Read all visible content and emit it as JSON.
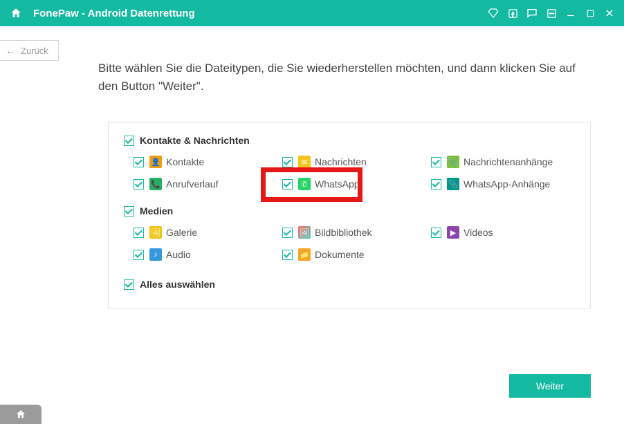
{
  "titlebar": {
    "title": "FonePaw - Android Datenrettung"
  },
  "back_button": "Zurück",
  "instruction": "Bitte wählen Sie die Dateitypen, die Sie wiederherstellen möchten, und dann klicken Sie auf den Button \"Weiter\".",
  "sections": {
    "contacts_messages": "Kontakte & Nachrichten",
    "media": "Medien",
    "select_all": "Alles auswählen"
  },
  "items": {
    "kontakte": "Kontakte",
    "nachrichten": "Nachrichten",
    "nachrichtenanhaenge": "Nachrichtenanhänge",
    "anrufverlauf": "Anrufverlauf",
    "whatsapp": "WhatsApp",
    "whatsapp_anhaenge": "WhatsApp-Anhänge",
    "galerie": "Galerie",
    "bildbibliothek": "Bildbibliothek",
    "videos": "Videos",
    "audio": "Audio",
    "dokumente": "Dokumente"
  },
  "next_button": "Weiter",
  "colors": {
    "accent": "#14b9a2",
    "highlight": "#e61717"
  }
}
